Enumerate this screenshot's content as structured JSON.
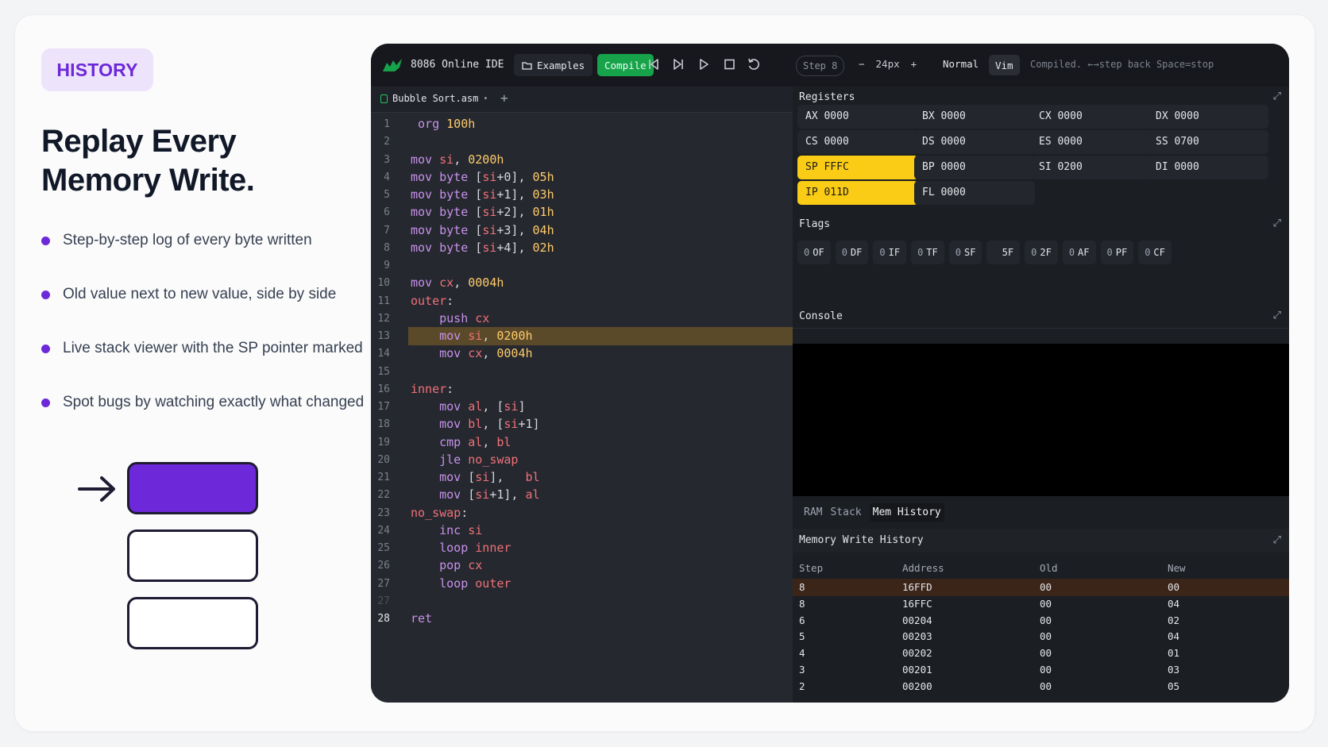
{
  "badge": "HISTORY",
  "headline": {
    "line1": "Replay Every",
    "line2": "Memory Write."
  },
  "bullets": [
    "Step-by-step log of every byte written",
    "Old value next to new value, side by side",
    "Live stack viewer with the SP pointer marked",
    "Spot bugs by watching exactly what changed"
  ],
  "colors": {
    "accent": "#6d28d9",
    "compile": "#16a34a",
    "highlight_reg": "#facc15"
  },
  "toolbar": {
    "title": "8086 Online IDE",
    "examples": "Examples",
    "compile": "Compile",
    "step": "Step 8",
    "font_minus": "−",
    "font_size": "24px",
    "font_plus": "+",
    "mode": "Normal",
    "vim": "Vim",
    "status": "Compiled. ←→step back Space=stop",
    "icons": [
      "folder-icon",
      "skip-back-icon",
      "step-forward-icon",
      "play-icon",
      "stop-icon",
      "reset-icon"
    ]
  },
  "editor": {
    "tab": "Bubble Sort.asm",
    "tab_marker": "•",
    "add_tab": "+",
    "lines": [
      {
        "n": "1",
        "t": [
          [
            " org ",
            "kw"
          ],
          [
            "100h",
            "nm"
          ]
        ]
      },
      {
        "n": "2",
        "t": []
      },
      {
        "n": "3",
        "t": [
          "mov ",
          "kw",
          "si",
          "rg",
          ", ",
          "pl",
          "0200h",
          "nm"
        ]
      },
      {
        "n": "4",
        "t": [
          "mov byte ",
          "kw",
          "[",
          "pl",
          "si",
          "rg",
          "+0], ",
          "pl",
          "05h",
          "nm"
        ]
      },
      {
        "n": "5",
        "t": [
          "mov byte ",
          "kw",
          "[",
          "pl",
          "si",
          "rg",
          "+1], ",
          "pl",
          "03h",
          "nm"
        ]
      },
      {
        "n": "6",
        "t": [
          "mov byte ",
          "kw",
          "[",
          "pl",
          "si",
          "rg",
          "+2], ",
          "pl",
          "01h",
          "nm"
        ]
      },
      {
        "n": "7",
        "t": [
          "mov byte ",
          "kw",
          "[",
          "pl",
          "si",
          "rg",
          "+3], ",
          "pl",
          "04h",
          "nm"
        ]
      },
      {
        "n": "8",
        "t": [
          "mov byte ",
          "kw",
          "[",
          "pl",
          "si",
          "rg",
          "+4], ",
          "pl",
          "02h",
          "nm"
        ]
      },
      {
        "n": "9",
        "t": []
      },
      {
        "n": "10",
        "t": [
          "mov ",
          "kw",
          "cx",
          "rg",
          ", ",
          "pl",
          "0004h",
          "nm"
        ]
      },
      {
        "n": "11",
        "t": [
          "outer",
          "lb",
          ":",
          "pl"
        ]
      },
      {
        "n": "12",
        "t": [
          "    push ",
          "kw",
          "cx",
          "rg"
        ]
      },
      {
        "n": "13",
        "t": [
          "    mov ",
          "kw",
          "si",
          "rg",
          ", ",
          "pl",
          "0200h",
          "nm"
        ],
        "hl": true
      },
      {
        "n": "14",
        "t": [
          "    mov ",
          "kw",
          "cx",
          "rg",
          ", ",
          "pl",
          "0004h",
          "nm"
        ]
      },
      {
        "n": "15",
        "t": []
      },
      {
        "n": "16",
        "t": [
          "inner",
          "lb",
          ":",
          "pl"
        ]
      },
      {
        "n": "17",
        "t": [
          "    mov ",
          "kw",
          "al",
          "rg",
          ", [",
          "pl",
          "si",
          "rg",
          "]",
          "pl"
        ]
      },
      {
        "n": "18",
        "t": [
          "    mov ",
          "kw",
          "bl",
          "rg",
          ", [",
          "pl",
          "si",
          "rg",
          "+1]",
          "pl"
        ]
      },
      {
        "n": "19",
        "t": [
          "    cmp ",
          "kw",
          "al",
          "rg",
          ", ",
          "pl",
          "bl",
          "rg"
        ]
      },
      {
        "n": "20",
        "t": [
          "    jle ",
          "kw",
          "no_swap",
          "lb"
        ]
      },
      {
        "n": "21",
        "t": [
          "    mov ",
          "kw",
          "[",
          "pl",
          "si",
          "rg",
          "],   ",
          "pl",
          "bl",
          "rg"
        ]
      },
      {
        "n": "22",
        "t": [
          "    mov ",
          "kw",
          "[",
          "pl",
          "si",
          "rg",
          "+1], ",
          "pl",
          "al",
          "rg"
        ]
      },
      {
        "n": "23",
        "t": [
          "no_swap",
          "lb",
          ":",
          "pl"
        ]
      },
      {
        "n": "24",
        "t": [
          "    inc ",
          "kw",
          "si",
          "rg"
        ]
      },
      {
        "n": "25",
        "t": [
          "    loop ",
          "kw",
          "inner",
          "lb"
        ]
      },
      {
        "n": "26",
        "t": [
          "    pop ",
          "kw",
          "cx",
          "rg"
        ]
      },
      {
        "n": "27",
        "t": [
          "    loop ",
          "kw",
          "outer",
          "lb"
        ]
      },
      {
        "n": "27",
        "t": [],
        "dim": true
      },
      {
        "n": "28",
        "t": [
          "ret",
          "kw"
        ],
        "cur": true
      }
    ]
  },
  "registers": {
    "title": "Registers",
    "items": [
      {
        "name": "AX",
        "value": "0000"
      },
      {
        "name": "BX",
        "value": "0000"
      },
      {
        "name": "CX",
        "value": "0000"
      },
      {
        "name": "DX",
        "value": "0000"
      },
      {
        "name": "CS",
        "value": "0000"
      },
      {
        "name": "DS",
        "value": "0000"
      },
      {
        "name": "ES",
        "value": "0000"
      },
      {
        "name": "SS",
        "value": "0700"
      },
      {
        "name": "SP",
        "value": "FFFC",
        "hot": true
      },
      {
        "name": "BP",
        "value": "0000"
      },
      {
        "name": "SI",
        "value": "0200"
      },
      {
        "name": "DI",
        "value": "0000"
      },
      {
        "name": "IP",
        "value": "011D",
        "hot": true
      },
      {
        "name": "FL",
        "value": "0000"
      }
    ]
  },
  "flags": {
    "title": "Flags",
    "items": [
      {
        "v": "0",
        "n": "OF"
      },
      {
        "v": "0",
        "n": "DF"
      },
      {
        "v": "0",
        "n": "IF"
      },
      {
        "v": "0",
        "n": "TF"
      },
      {
        "v": "0",
        "n": "SF"
      },
      {
        "v": "",
        "n": "5F"
      },
      {
        "v": "0",
        "n": "2F"
      },
      {
        "v": "0",
        "n": "AF"
      },
      {
        "v": "0",
        "n": "PF"
      },
      {
        "v": "0",
        "n": "CF"
      }
    ]
  },
  "console": {
    "title": "Console"
  },
  "bottom_tabs": [
    "RAM",
    "Stack",
    "Mem History"
  ],
  "mem_history": {
    "title": "Memory Write History",
    "headers": [
      "Step",
      "Address",
      "Old",
      "New"
    ],
    "rows": [
      [
        "8",
        "16FFD",
        "00",
        "00"
      ],
      [
        "8",
        "16FFC",
        "00",
        "04"
      ],
      [
        "6",
        "00204",
        "00",
        "02"
      ],
      [
        "5",
        "00203",
        "00",
        "04"
      ],
      [
        "4",
        "00202",
        "00",
        "01"
      ],
      [
        "3",
        "00201",
        "00",
        "03"
      ],
      [
        "2",
        "00200",
        "00",
        "05"
      ]
    ]
  }
}
